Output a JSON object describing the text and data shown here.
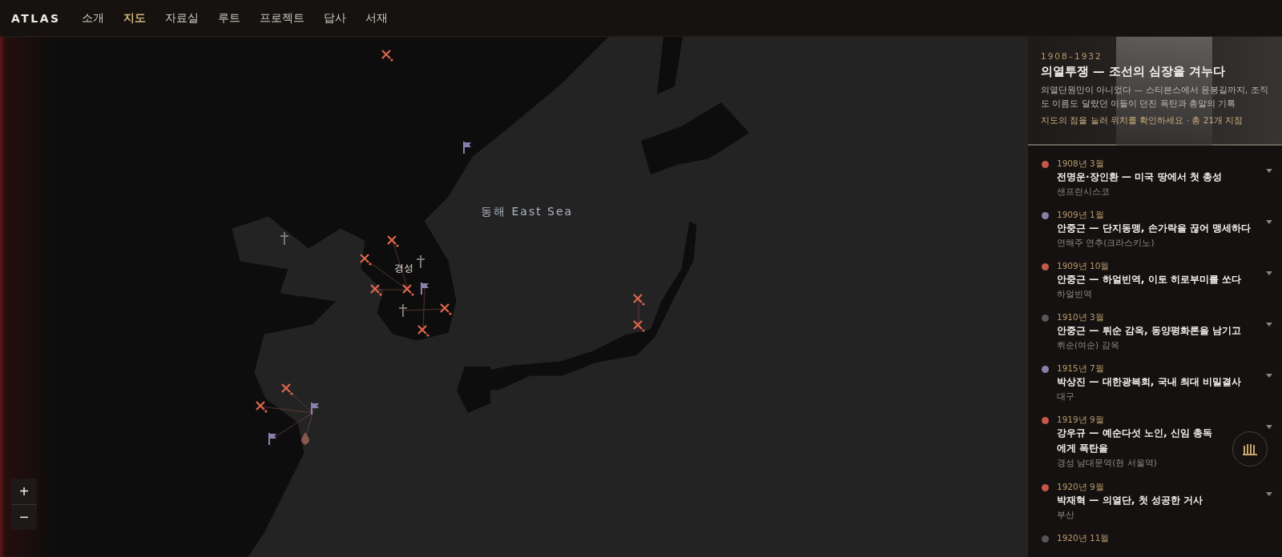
{
  "header": {
    "logo": "ATLAS",
    "nav": [
      {
        "label": "소개",
        "selected": false
      },
      {
        "label": "지도",
        "selected": true
      },
      {
        "label": "자료실",
        "selected": false
      },
      {
        "label": "루트",
        "selected": false
      },
      {
        "label": "프로젝트",
        "selected": false
      },
      {
        "label": "답사",
        "selected": false
      },
      {
        "label": "서재",
        "selected": false
      }
    ]
  },
  "map": {
    "sea_label": "동해 East Sea",
    "city_label": "경성",
    "zoom_in": "+",
    "zoom_out": "−",
    "markers": [
      {
        "kind": "strike"
      },
      {
        "kind": "flag"
      },
      {
        "kind": "cross"
      },
      {
        "kind": "strike"
      },
      {
        "kind": "strike"
      },
      {
        "kind": "cross"
      },
      {
        "kind": "strike"
      },
      {
        "kind": "strike"
      },
      {
        "kind": "flag"
      },
      {
        "kind": "cross"
      },
      {
        "kind": "strike"
      },
      {
        "kind": "strike"
      },
      {
        "kind": "strike"
      },
      {
        "kind": "strike"
      },
      {
        "kind": "strike"
      },
      {
        "kind": "strike"
      },
      {
        "kind": "flag"
      },
      {
        "kind": "flag"
      },
      {
        "kind": "drop"
      }
    ]
  },
  "sidebar": {
    "hero": {
      "period": "1908–1932",
      "title": "의열투쟁 — 조선의 심장을 겨누다",
      "description": "의열단원만이 아니었다 — 스티븐스에서 윤봉길까지, 조직도 이름도 달랐던 이들이 던진 폭탄과 총알의 기록",
      "hint": "지도의 점을 눌러 위치를 확인하세요 · 총 21개 지점"
    },
    "events": [
      {
        "date": "1908년 3월",
        "title": "전명운·장인환 — 미국 땅에서 첫 총성",
        "place": "샌프란시스코",
        "color": "#c4584a"
      },
      {
        "date": "1909년 1월",
        "title": "안중근 — 단지동맹, 손가락을 끊어 맹세하다",
        "place": "연해주 연추(크라스키노)",
        "color": "#8a7fa8"
      },
      {
        "date": "1909년 10월",
        "title": "안중근 — 하얼빈역, 이토 히로부미를 쏘다",
        "place": "하얼빈역",
        "color": "#c4584a"
      },
      {
        "date": "1910년 3월",
        "title": "안중근 — 뤼순 감옥, 동양평화론을 남기고",
        "place": "뤼순(여순) 감옥",
        "color": "#555555"
      },
      {
        "date": "1915년 7월",
        "title": "박상진 — 대한광복회, 국내 최대 비밀결사",
        "place": "대구",
        "color": "#8a7fa8"
      },
      {
        "date": "1919년 9월",
        "title": "강우규 — 예순다섯 노인, 신임 총독에게 폭탄을",
        "place": "경성 남대문역(현 서울역)",
        "color": "#c4584a"
      },
      {
        "date": "1920년 9월",
        "title": "박재혁 — 의열단, 첫 성공한 거사",
        "place": "부산",
        "color": "#c4584a"
      },
      {
        "date": "1920년 11월",
        "color": "#555555"
      }
    ]
  }
}
